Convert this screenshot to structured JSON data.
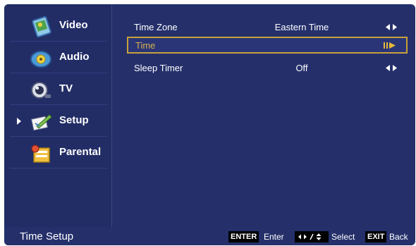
{
  "sidebar": {
    "items": [
      {
        "label": "Video",
        "icon": "video-icon"
      },
      {
        "label": "Audio",
        "icon": "audio-icon"
      },
      {
        "label": "TV",
        "icon": "tv-icon"
      },
      {
        "label": "Setup",
        "icon": "setup-icon",
        "active": true
      },
      {
        "label": "Parental",
        "icon": "parental-icon"
      }
    ]
  },
  "settings": {
    "rows": [
      {
        "name": "Time Zone",
        "value": "Eastern Time"
      },
      {
        "name": "Time",
        "value": ""
      },
      {
        "name": "Sleep Timer",
        "value": "Off"
      }
    ],
    "selected_index": 1
  },
  "status": {
    "title": "Time Setup",
    "enter_key": "ENTER",
    "enter_label": "Enter",
    "select_label": "Select",
    "exit_key": "EXIT",
    "exit_label": "Back"
  },
  "colors": {
    "background": "#25306b",
    "highlight": "#c8a03a",
    "text": "#ffffff"
  }
}
